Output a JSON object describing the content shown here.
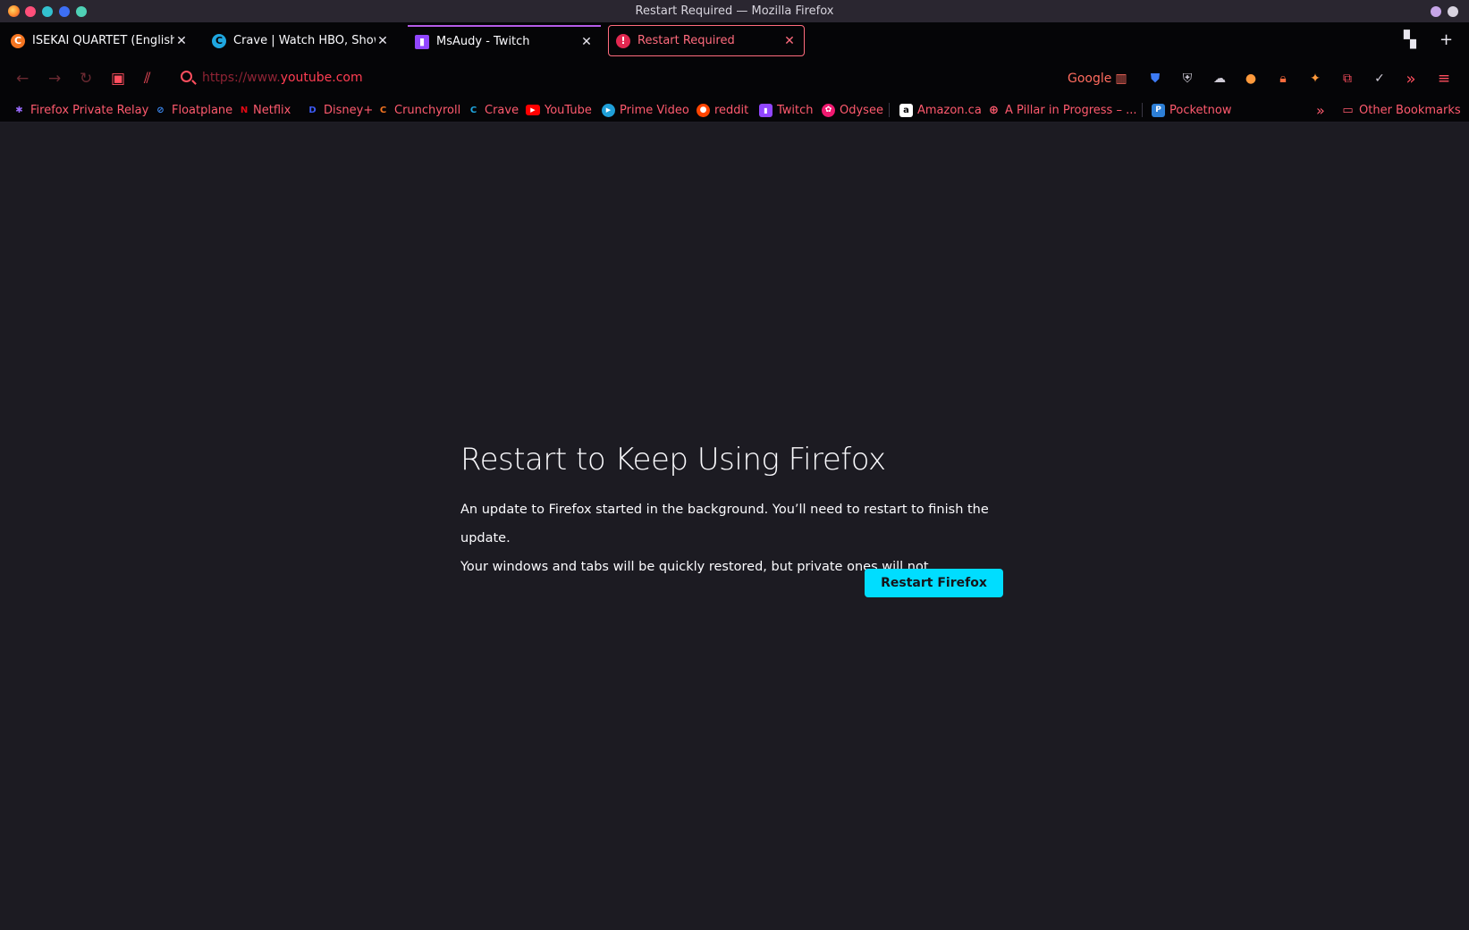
{
  "window": {
    "title": "Restart Required — Mozilla Firefox"
  },
  "tabs": [
    {
      "label": "ISEKAI QUARTET (English D",
      "icon": "crunchyroll-icon"
    },
    {
      "label": "Crave | Watch HBO, Showtim",
      "icon": "crave-icon"
    },
    {
      "label": "MsAudy - Twitch",
      "icon": "twitch-icon"
    },
    {
      "label": "Restart Required",
      "icon": "alert-icon"
    }
  ],
  "urlbar": {
    "prefix": "https://www.",
    "domain": "youtube.com"
  },
  "search_engine_label": "Google",
  "bookmarks": [
    {
      "label": "Firefox Private Relay",
      "icon": "relay-icon"
    },
    {
      "label": "Floatplane",
      "icon": "floatplane-icon"
    },
    {
      "label": "Netflix",
      "icon": "netflix-icon"
    },
    {
      "label": "Disney+",
      "icon": "disney-icon"
    },
    {
      "label": "Crunchyroll",
      "icon": "crunchyroll-icon"
    },
    {
      "label": "Crave",
      "icon": "crave-icon"
    },
    {
      "label": "YouTube",
      "icon": "youtube-icon"
    },
    {
      "label": "Prime Video",
      "icon": "prime-video-icon"
    },
    {
      "label": "reddit",
      "icon": "reddit-icon"
    },
    {
      "label": "Twitch",
      "icon": "twitch-icon"
    },
    {
      "label": "Odysee",
      "icon": "odysee-icon"
    },
    {
      "label": "Amazon.ca",
      "icon": "amazon-icon"
    },
    {
      "label": "A Pillar in Progress – ...",
      "icon": "globe-icon"
    },
    {
      "label": "Pocketnow",
      "icon": "pocketnow-icon"
    }
  ],
  "other_bookmarks": "Other Bookmarks",
  "page": {
    "title": "Restart to Keep Using Firefox",
    "line1": "An update to Firefox started in the background. You’ll need to restart to finish the update.",
    "line2": "Your windows and tabs will be quickly restored, but private ones will not.",
    "button": "Restart Firefox"
  },
  "colors": {
    "accent": "#ff4e5e",
    "button": "#00ddff",
    "page_bg": "#1c1b22",
    "toolbar_bg": "#050507"
  }
}
